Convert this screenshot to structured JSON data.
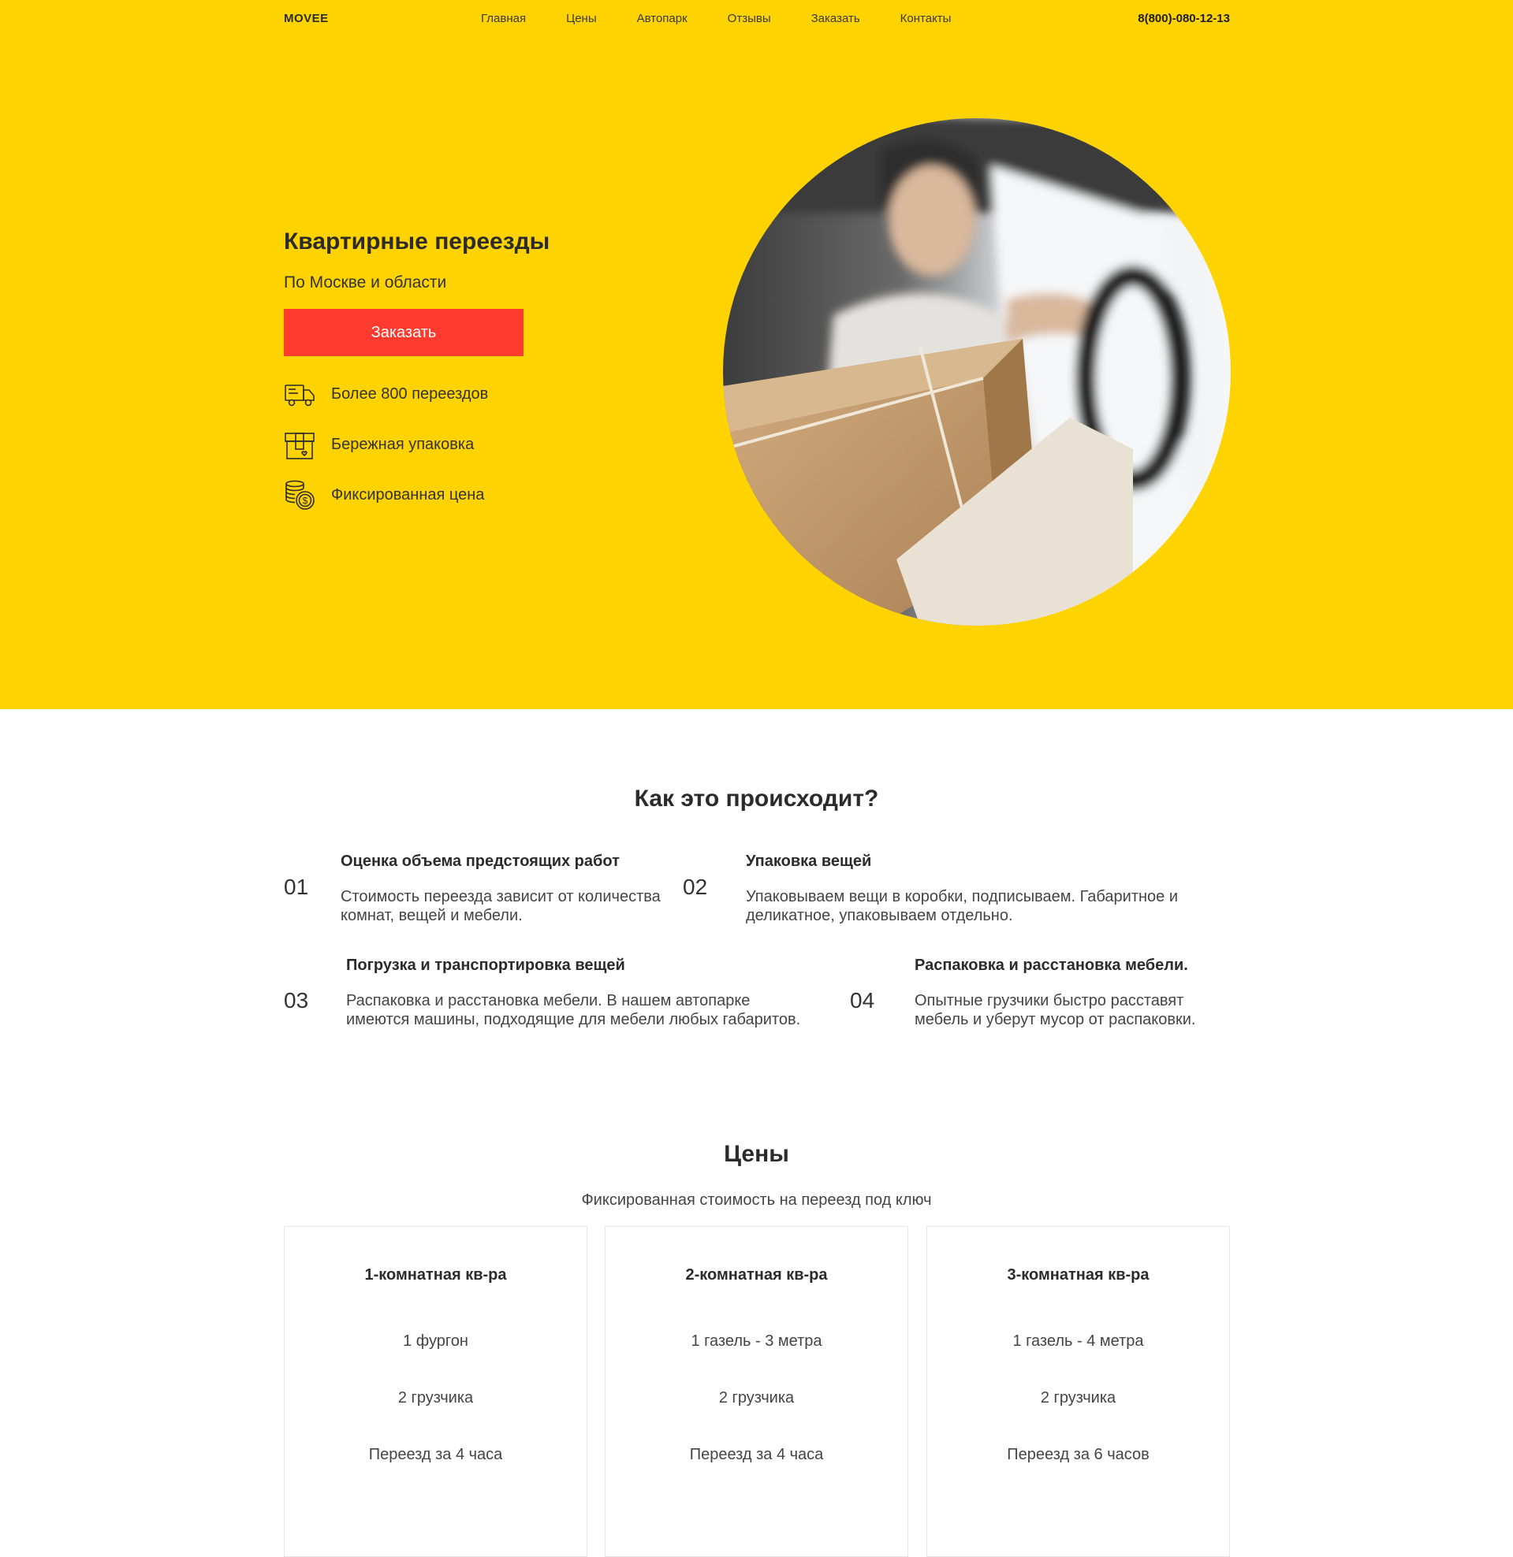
{
  "header": {
    "logo": "MOVEE",
    "nav": [
      "Главная",
      "Цены",
      "Автопарк",
      "Отзывы",
      "Заказать",
      "Контакты"
    ],
    "phone": "8(800)-080-12-13"
  },
  "hero": {
    "title": "Квартирные переезды",
    "subtitle": "По Москве и области",
    "cta": "Заказать",
    "features": [
      {
        "icon": "truck-icon",
        "text": "Более 800 переездов"
      },
      {
        "icon": "box-icon",
        "text": "Бережная упаковка"
      },
      {
        "icon": "coins-icon",
        "text": "Фиксированная цена"
      }
    ]
  },
  "steps": {
    "title": "Как это происходит?",
    "items": [
      {
        "num": "01",
        "title": "Оценка объема предстоящих работ",
        "text": "Стоимость переезда зависит от количества комнат, вещей и мебели."
      },
      {
        "num": "02",
        "title": "Упаковка вещей",
        "text": "Упаковываем вещи в коробки, подписываем. Габаритное и деликатное, упаковываем отдельно."
      },
      {
        "num": "03",
        "title": "Погрузка и транспортировка вещей",
        "text": "Распаковка и расстановка мебели. В нашем автопарке имеются машины, подходящие для мебели любых габаритов."
      },
      {
        "num": "04",
        "title": "Распаковка и расстановка мебели.",
        "text": "Опытные грузчики быстро расставят мебель и уберут мусор от распаковки."
      }
    ]
  },
  "prices": {
    "title": "Цены",
    "subtitle": "Фиксированная стоимость на переезд под ключ",
    "cards": [
      {
        "title": "1-комнатная кв-ра",
        "lines": [
          "1 фургон",
          "2 грузчика",
          "Переезд за 4 часа"
        ]
      },
      {
        "title": "2-комнатная кв-ра",
        "lines": [
          "1 газель - 3 метра",
          "2 грузчика",
          "Переезд за 4 часа"
        ]
      },
      {
        "title": "3-комнатная кв-ра",
        "lines": [
          "1 газель - 4 метра",
          "2 грузчика",
          "Переезд за 6 часов"
        ]
      }
    ]
  },
  "colors": {
    "accent_yellow": "#ffd300",
    "cta_red": "#ff3b2f"
  }
}
